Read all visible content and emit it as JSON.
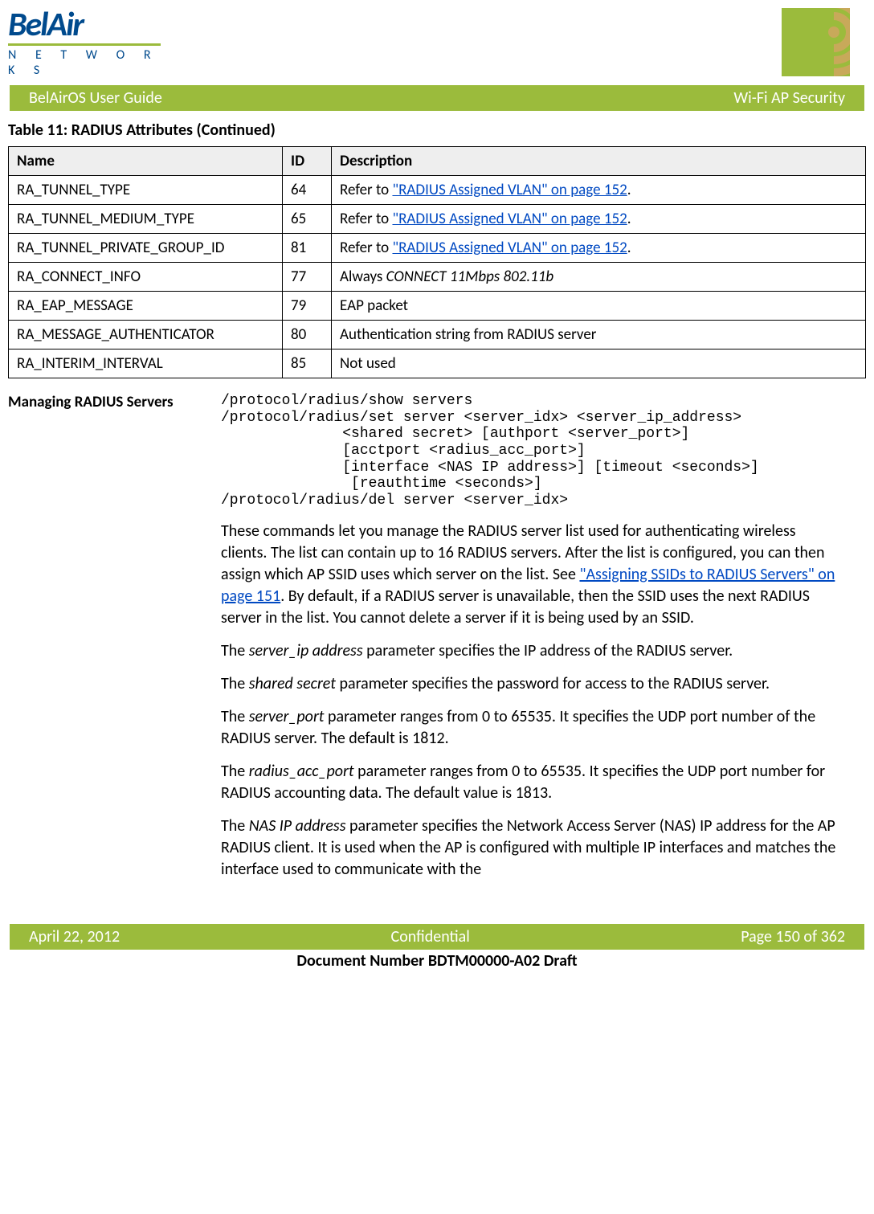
{
  "header": {
    "logo_top": "BelAir",
    "logo_bottom": "N E T W O R K S",
    "ribbon_left": "BelAirOS User Guide",
    "ribbon_right": "Wi-Fi AP Security"
  },
  "table": {
    "title": "Table 11: RADIUS Attributes  (Continued)",
    "headers": {
      "name": "Name",
      "id": "ID",
      "desc": "Description"
    },
    "xref_text": "\"RADIUS Assigned VLAN\" on page 152",
    "rows": [
      {
        "name": "RA_TUNNEL_TYPE",
        "id": "64",
        "desc_prefix": "Refer to ",
        "desc_link": true,
        "desc_suffix": "."
      },
      {
        "name": "RA_TUNNEL_MEDIUM_TYPE",
        "id": "65",
        "desc_prefix": "Refer to ",
        "desc_link": true,
        "desc_suffix": "."
      },
      {
        "name": "RA_TUNNEL_PRIVATE_GROUP_ID",
        "id": "81",
        "desc_prefix": "Refer to ",
        "desc_link": true,
        "desc_suffix": "."
      },
      {
        "name": "RA_CONNECT_INFO",
        "id": "77",
        "desc_prefix": "Always ",
        "desc_italic": "CONNECT 11Mbps 802.11b"
      },
      {
        "name": "RA_EAP_MESSAGE",
        "id": "79",
        "desc_plain": "EAP packet"
      },
      {
        "name": "RA_MESSAGE_AUTHENTICATOR",
        "id": "80",
        "desc_plain": "Authentication string from RADIUS server"
      },
      {
        "name": "RA_INTERIM_INTERVAL",
        "id": "85",
        "desc_plain": "Not used"
      }
    ]
  },
  "section": {
    "heading": "Managing RADIUS Servers",
    "cmd": "/protocol/radius/show servers\n/protocol/radius/set server <server_idx> <server_ip_address>\n              <shared secret> [authport <server_port>]\n              [acctport <radius_acc_port>]\n              [interface <NAS IP address>] [timeout <seconds>]\n               [reauthtime <seconds>]\n/protocol/radius/del server <server_idx>",
    "p1_a": "These commands let you manage the RADIUS server list used for authenticating wireless clients. The list can contain up to 16 RADIUS servers. After the list is configured, you can then assign which AP SSID uses which server on the list. See ",
    "p1_link": "\"Assigning SSIDs to RADIUS Servers\" on page 151",
    "p1_b": ". By default, if a RADIUS server is unavailable, then the SSID uses the next RADIUS server in the list. You cannot delete a server if it is being used by an SSID.",
    "p2_a": "The ",
    "p2_i": "server_ip address",
    "p2_b": " parameter specifies the IP address of the RADIUS server.",
    "p3_a": "The ",
    "p3_i": "shared secret",
    "p3_b": " parameter specifies the password for access to the RADIUS server.",
    "p4_a": "The ",
    "p4_i": "server_port",
    "p4_b": " parameter ranges from 0 to 65535. It specifies the UDP port number of the RADIUS server. The default is 1812.",
    "p5_a": "The ",
    "p5_i": "radius_acc_port",
    "p5_b": " parameter ranges from 0 to 65535. It specifies the UDP port number for RADIUS accounting data. The default value is 1813.",
    "p6_a": "The ",
    "p6_i": "NAS IP address",
    "p6_b": " parameter specifies the Network Access Server (NAS) IP address for the AP RADIUS client. It is used when the AP is configured with multiple IP interfaces and matches the interface used to communicate with the"
  },
  "footer": {
    "left": "April 22, 2012",
    "center": "Confidential",
    "right": "Page 150 of 362",
    "docnum": "Document Number BDTM00000-A02 Draft"
  }
}
